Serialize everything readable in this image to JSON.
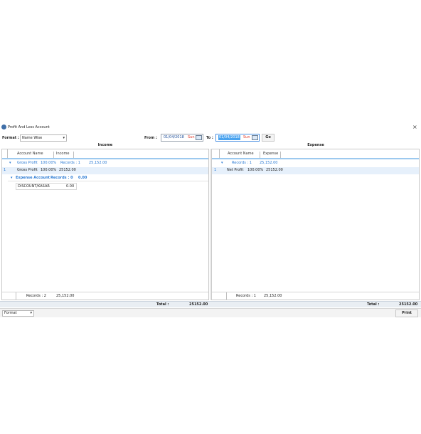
{
  "window": {
    "title": "Profit And Loss Account",
    "close_glyph": "×"
  },
  "toolbar": {
    "format_label": "Format :",
    "format_value": "Name Wise",
    "from_label": "From :",
    "from_date": "01/04/2018",
    "from_day": "Sun",
    "to_label": "To :",
    "to_date": "01/04/2018",
    "to_day": "Sun",
    "go_label": "Go"
  },
  "income": {
    "title": "Income",
    "columns": [
      "Account Name",
      "Income"
    ],
    "group1": {
      "label": "Gross Profit",
      "percent": "100.00%",
      "records": "Records : 1",
      "total": "25,152.00"
    },
    "row1": {
      "indicator": "1",
      "name": "Gross Profit",
      "percent": "100.00%",
      "amount": "25152.00"
    },
    "group2": {
      "label": "Expense Account",
      "records": "Records : 0",
      "total": "0.00"
    },
    "row2": {
      "name": "DISCOUNT/KASAR",
      "amount": "0.00"
    },
    "footer": {
      "records": "Records : 2",
      "total": "25,152.00"
    }
  },
  "expense": {
    "title": "Expense",
    "columns": [
      "Account Name",
      "Expense"
    ],
    "group1": {
      "records": "Records : 1",
      "total": "25,152.00"
    },
    "row1": {
      "indicator": "1",
      "name": "Net Profit",
      "percent": "100.00%",
      "amount": "25152.00"
    },
    "footer": {
      "records": "Records : 1",
      "total": "25,152.00"
    }
  },
  "totals": {
    "label": "Total :",
    "income_total": "25152.00",
    "expense_total": "25152.00"
  },
  "bottom": {
    "format_value": "Format",
    "print_label": "Print"
  },
  "colors": {
    "accent": "#2a7ad4",
    "header_underline": "#9cc9ef",
    "selected_row": "#e6f0fb"
  }
}
